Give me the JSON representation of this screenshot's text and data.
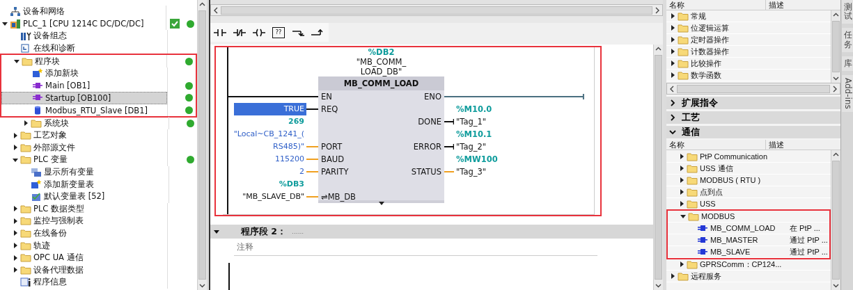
{
  "project_tree": {
    "items": [
      {
        "label": "设备和网络",
        "kind": "network",
        "online": false,
        "checked": false,
        "selected": false
      },
      {
        "label": "PLC_1 [CPU 1214C DC/DC/DC]",
        "kind": "plc",
        "expanded": true,
        "online": true,
        "checked": true,
        "selected": false,
        "children": [
          {
            "label": "设备组态",
            "kind": "config",
            "online": false,
            "checked": false,
            "selected": false
          },
          {
            "label": "在线和诊断",
            "kind": "diag",
            "online": false,
            "checked": false,
            "selected": false
          },
          {
            "label": "程序块",
            "kind": "folder",
            "expanded": true,
            "online": true,
            "checked": false,
            "selected": false,
            "framed": true,
            "children": [
              {
                "label": "添加新块",
                "kind": "add",
                "online": false,
                "checked": false,
                "selected": false,
                "framed": true
              },
              {
                "label": "Main [OB1]",
                "kind": "ob",
                "online": true,
                "checked": false,
                "selected": false,
                "framed": true
              },
              {
                "label": "Startup [OB100]",
                "kind": "ob",
                "online": true,
                "checked": false,
                "selected": true,
                "framed": true
              },
              {
                "label": "Modbus_RTU_Slave [DB1]",
                "kind": "db",
                "online": true,
                "checked": false,
                "selected": false,
                "framed": true
              },
              {
                "label": "系统块",
                "kind": "folder",
                "expanded": false,
                "online": true,
                "checked": false,
                "selected": false
              }
            ]
          },
          {
            "label": "工艺对象",
            "kind": "folder",
            "expanded": false,
            "online": false,
            "checked": false,
            "selected": false
          },
          {
            "label": "外部源文件",
            "kind": "folder",
            "expanded": false,
            "online": false,
            "checked": false,
            "selected": false
          },
          {
            "label": "PLC 变量",
            "kind": "folder",
            "expanded": true,
            "online": true,
            "checked": false,
            "selected": false,
            "children": [
              {
                "label": "显示所有变量",
                "kind": "tags",
                "online": false,
                "checked": false,
                "selected": false
              },
              {
                "label": "添加新变量表",
                "kind": "add",
                "online": false,
                "checked": false,
                "selected": false
              },
              {
                "label": "默认变量表 [52]",
                "kind": "table",
                "online": false,
                "checked": false,
                "selected": false
              }
            ]
          },
          {
            "label": "PLC 数据类型",
            "kind": "folder",
            "expanded": false,
            "online": false,
            "checked": false,
            "selected": false
          },
          {
            "label": "监控与强制表",
            "kind": "folder",
            "expanded": false,
            "online": false,
            "checked": false,
            "selected": false
          },
          {
            "label": "在线备份",
            "kind": "folder",
            "expanded": false,
            "online": false,
            "checked": false,
            "selected": false
          },
          {
            "label": "轨迹",
            "kind": "folder",
            "expanded": false,
            "online": false,
            "checked": false,
            "selected": false
          },
          {
            "label": "OPC UA 通信",
            "kind": "folder",
            "expanded": false,
            "online": false,
            "checked": false,
            "selected": false
          },
          {
            "label": "设备代理数据",
            "kind": "folder",
            "expanded": false,
            "online": false,
            "checked": false,
            "selected": false
          },
          {
            "label": "程序信息",
            "kind": "info",
            "online": false,
            "checked": false,
            "selected": false
          }
        ]
      }
    ]
  },
  "editor": {
    "toolbar": [
      {
        "kind": "contact"
      },
      {
        "kind": "negated_contact"
      },
      {
        "kind": "coil"
      },
      {
        "kind": "box",
        "label": "??"
      },
      {
        "kind": "branch_open"
      },
      {
        "kind": "branch_close"
      }
    ],
    "network_1": {
      "framed": true,
      "instance": {
        "address": "%DB2",
        "name_lines": [
          "\"MB_COMM_",
          "LOAD_DB\""
        ]
      },
      "block": {
        "title": "MB_COMM_LOAD",
        "inputs": [
          {
            "pin": "EN",
            "kind": "power"
          },
          {
            "pin": "REQ",
            "kind": "bool",
            "operand": {
              "kind": "constant",
              "lines": [
                "TRUE"
              ],
              "selected": true
            }
          },
          {
            "pin": "PORT",
            "kind": "data",
            "address": "269",
            "operand": {
              "kind": "constant",
              "lines": [
                "\"Local~CB_1241_(",
                "RS485)\""
              ],
              "selected": false
            }
          },
          {
            "pin": "BAUD",
            "kind": "data",
            "operand": {
              "kind": "constant",
              "lines": [
                "115200"
              ],
              "selected": false
            }
          },
          {
            "pin": "PARITY",
            "kind": "data",
            "operand": {
              "kind": "constant",
              "lines": [
                "2"
              ],
              "selected": false
            }
          },
          {
            "pin": "⇌MB_DB",
            "kind": "data",
            "address": "%DB3",
            "operand": {
              "kind": "tag",
              "lines": [
                "\"MB_SLAVE_DB\""
              ],
              "selected": false
            }
          }
        ],
        "outputs": [
          {
            "pin": "ENO",
            "kind": "power"
          },
          {
            "pin": "DONE",
            "kind": "bool",
            "address": "%M10.0",
            "operand": {
              "kind": "tag",
              "lines": [
                "\"Tag_1\""
              ],
              "selected": false
            }
          },
          {
            "pin": "ERROR",
            "kind": "bool",
            "address": "%M10.1",
            "operand": {
              "kind": "tag",
              "lines": [
                "\"Tag_2\""
              ],
              "selected": false
            }
          },
          {
            "pin": "STATUS",
            "kind": "data",
            "address": "%MW100",
            "operand": {
              "kind": "tag",
              "lines": [
                "\"Tag_3\""
              ],
              "selected": false
            }
          }
        ]
      }
    },
    "network_2": {
      "expanded": true,
      "title": "程序段 2：",
      "title_comment": "......",
      "comment_placeholder": "注释"
    }
  },
  "instructions": {
    "columns": [
      "名称",
      "描述"
    ],
    "items": [
      {
        "label": "常规",
        "kind": "folder",
        "expanded": false
      },
      {
        "label": "位逻辑运算",
        "kind": "folder",
        "expanded": false
      },
      {
        "label": "定时器操作",
        "kind": "folder",
        "expanded": false
      },
      {
        "label": "计数器操作",
        "kind": "folder",
        "expanded": false
      },
      {
        "label": "比较操作",
        "kind": "folder",
        "expanded": false
      },
      {
        "label": "数学函数",
        "kind": "folder",
        "expanded": false
      }
    ],
    "sections": [
      {
        "title": "扩展指令",
        "expanded": false
      },
      {
        "title": "工艺",
        "expanded": false
      },
      {
        "title": "通信",
        "expanded": true,
        "columns": [
          "名称",
          "描述"
        ],
        "items": [
          {
            "expanded": true,
            "children": [
              {
                "label": "PtP Communication",
                "kind": "folder",
                "expanded": false
              },
              {
                "label": "USS 通信",
                "kind": "folder",
                "expanded": false
              },
              {
                "label": "MODBUS ( RTU )",
                "kind": "folder",
                "expanded": false
              },
              {
                "label": "点到点",
                "kind": "folder",
                "expanded": false
              },
              {
                "label": "USS",
                "kind": "folder",
                "expanded": false
              },
              {
                "label": "MODBUS",
                "kind": "folder",
                "expanded": true,
                "framed": true,
                "children": [
                  {
                    "label": "MB_COMM_LOAD",
                    "kind": "fb",
                    "description": "在 PtP ...",
                    "framed": true
                  },
                  {
                    "label": "MB_MASTER",
                    "kind": "fb",
                    "description": "通过 PtP ...",
                    "framed": true
                  },
                  {
                    "label": "MB_SLAVE",
                    "kind": "fb",
                    "description": "通过 PtP ...",
                    "framed": true
                  }
                ]
              },
              {
                "label": "GPRSComm：CP124...",
                "kind": "folder",
                "expanded": false
              }
            ]
          },
          {
            "label": "远程服务",
            "kind": "folder",
            "expanded": false
          }
        ]
      }
    ]
  },
  "side_tabs": [
    {
      "label": "测试",
      "kind": "upright",
      "selected": false
    },
    {
      "label": "任务",
      "kind": "upright",
      "selected": false
    },
    {
      "label": "库",
      "kind": "upright",
      "selected": false
    },
    {
      "label": "Add-ins",
      "kind": "rotated",
      "selected": false
    }
  ]
}
